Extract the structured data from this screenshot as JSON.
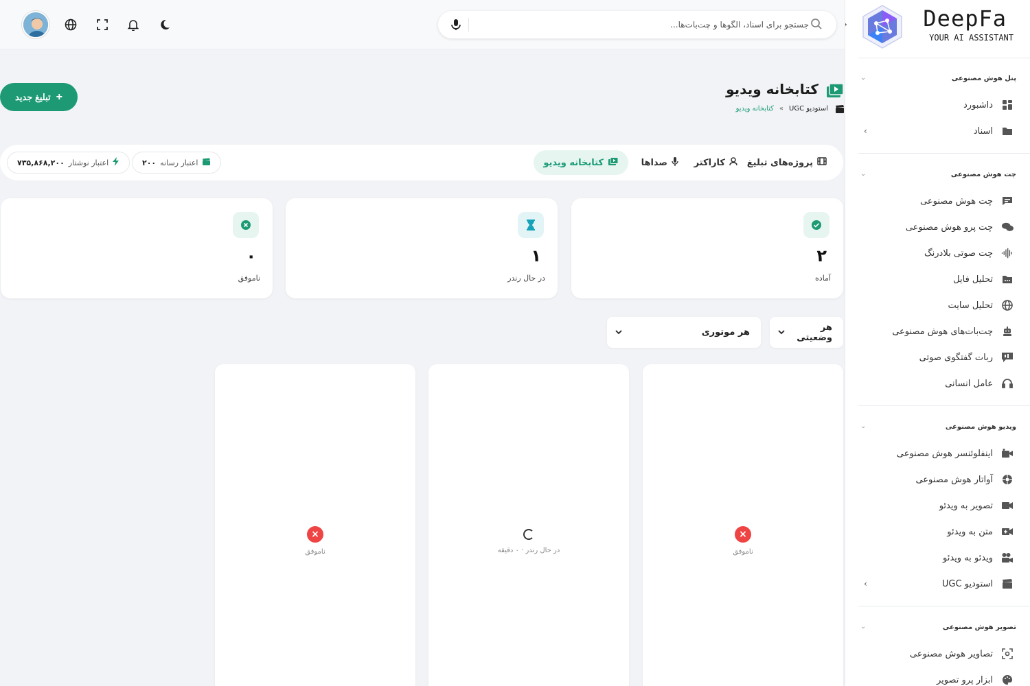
{
  "brand": {
    "title": "DeepFa",
    "subtitle": "YOUR AI ASSISTANT"
  },
  "search": {
    "placeholder": "جستجو برای اسناد، الگوها و چت‌بات‌ها..."
  },
  "sidebar": {
    "sections": [
      {
        "title": "پنل هوش مصنوعی",
        "items": [
          {
            "label": "داشبورد",
            "icon": "dashboard-icon"
          },
          {
            "label": "اسناد",
            "icon": "folder-icon"
          }
        ]
      },
      {
        "title": "چت هوش مصنوعی",
        "items": [
          {
            "label": "چت هوش مصنوعی",
            "icon": "chat-icon"
          },
          {
            "label": "چت پرو هوش مصنوعی",
            "icon": "chat-pro-icon"
          },
          {
            "label": "چت صوتی بلادرنگ",
            "icon": "waveform-icon"
          },
          {
            "label": "تحلیل فایل",
            "icon": "file-icon"
          },
          {
            "label": "تحلیل سایت",
            "icon": "globe-icon"
          },
          {
            "label": "چت‌بات‌های هوش مصنوعی",
            "icon": "robot-icon"
          },
          {
            "label": "ربات گفتگوی صوتی",
            "icon": "voice-bot-icon"
          },
          {
            "label": "عامل انسانی",
            "icon": "headset-icon"
          }
        ]
      },
      {
        "title": "ویدیو هوش مصنوعی",
        "items": [
          {
            "label": "اینفلوئنسر هوش مصنوعی",
            "icon": "influencer-icon"
          },
          {
            "label": "آواتار هوش مصنوعی",
            "icon": "avatar-icon"
          },
          {
            "label": "تصویر به ویدئو",
            "icon": "video-camera-icon"
          },
          {
            "label": "متن به ویدئو",
            "icon": "video-plus-icon"
          },
          {
            "label": "ویدئو به ویدئو",
            "icon": "video-reel-icon"
          },
          {
            "label": "استودیو UGC",
            "icon": "clapper-icon"
          }
        ]
      },
      {
        "title": "تصویر هوش مصنوعی",
        "items": [
          {
            "label": "تصاویر هوش مصنوعی",
            "icon": "image-scan-icon"
          },
          {
            "label": "ابزار پرو تصویر",
            "icon": "palette-icon"
          }
        ]
      }
    ]
  },
  "page": {
    "title": "کتابخانه ویدیو",
    "breadcrumb": {
      "parent": "استودیو UGC",
      "separator": "»",
      "current": "کتابخانه ویدیو"
    },
    "new_button": "تبلیغ جدید"
  },
  "tabs": [
    {
      "label": "پروژه‌های تبلیغ",
      "icon": "film-icon"
    },
    {
      "label": "کاراکتر",
      "icon": "user-icon"
    },
    {
      "label": "صداها",
      "icon": "mic-icon"
    },
    {
      "label": "کتابخانه ویدیو",
      "icon": "video-library-icon",
      "active": true
    }
  ],
  "credits": [
    {
      "label": "اعتبار رسانه",
      "value": "۲۰۰",
      "icon": "clapper-icon"
    },
    {
      "label": "اعتبار نوشتار",
      "value": "۷۳۵,۸۶۸,۲۰۰",
      "icon": "bolt-icon"
    }
  ],
  "stats": [
    {
      "label": "آماده",
      "value": "۲",
      "icon": "check-icon"
    },
    {
      "label": "در حال رندر",
      "value": "۱",
      "icon": "hourglass-icon"
    },
    {
      "label": "ناموفق",
      "value": "۰",
      "icon": "x-circle-icon"
    }
  ],
  "filters": {
    "status": "هر وضعیتی",
    "engine": "هر موتوری"
  },
  "videos": [
    {
      "status": "failed",
      "text": "ناموفق"
    },
    {
      "status": "rendering",
      "text": "در حال رندر · ۰ دقیقه"
    },
    {
      "status": "failed",
      "text": "ناموفق"
    }
  ],
  "colors": {
    "accent": "#1d9a73",
    "accent_light": "#e6f5ef",
    "danger": "#ef4444"
  }
}
